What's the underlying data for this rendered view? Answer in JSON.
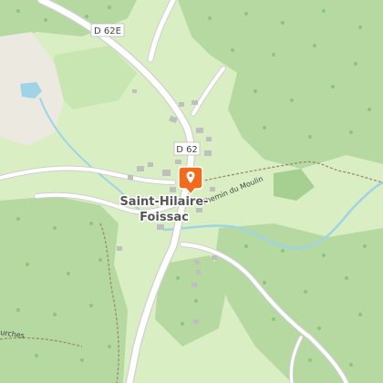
{
  "map": {
    "colors": {
      "background": "#d9efc3",
      "forest": "#b5d9a1",
      "forest_dark": "#a6cf92",
      "bare": "#ece9e0",
      "water": "#9fd3e6",
      "road": "#ffffff",
      "road_casing": "#cfcfcf",
      "building": "#bfbfbf",
      "marker": "#f26a1b",
      "path": "#9c8a6a"
    },
    "road_labels": {
      "d62e": "D 62E",
      "d62": "D 62"
    },
    "place": {
      "line1": "Saint-Hilaire-",
      "line2": "Foissac"
    },
    "street_label": "Chemin du Moulin",
    "partial_label": "urches",
    "marker_icon": "map-pin-icon"
  }
}
